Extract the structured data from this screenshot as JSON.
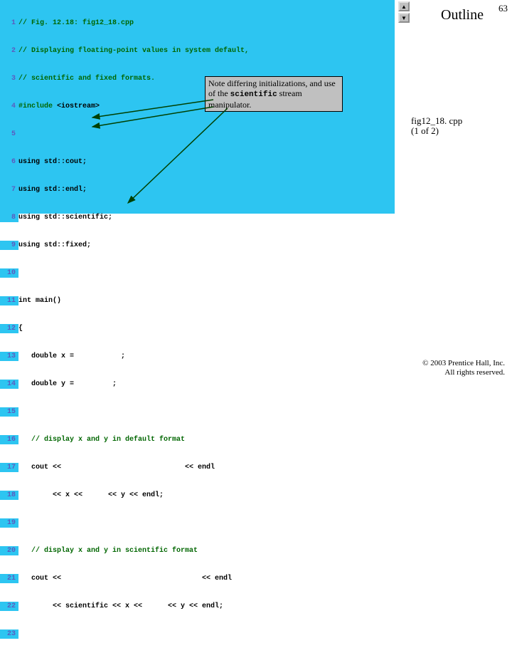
{
  "pageNumber": "63",
  "outlineLabel": "Outline",
  "nav": {
    "up": "▲",
    "down": "▼"
  },
  "figRefLine1": "fig12_18. cpp",
  "figRefLine2": "(1 of 2)",
  "callout": {
    "part1": "Note differing initializations, and use of the ",
    "mono": "scientific",
    "part2": " stream manipulator."
  },
  "footer": {
    "line1": "© 2003 Prentice Hall, Inc.",
    "line2": "All rights reserved."
  },
  "code": {
    "l1": "// Fig. 12.18: fig12_18.cpp",
    "l2": "// Displaying floating-point values in system default,",
    "l3": "// scientific and fixed formats.",
    "l4a": "#include ",
    "l4b": "<iostream>",
    "l5": "",
    "l6a": "using ",
    "l6b": "std::cout;",
    "l7a": "using ",
    "l7b": "std::endl;",
    "l8a": "using ",
    "l8b": "std::scientific;",
    "l9a": "using ",
    "l9b": "std::fixed;",
    "l10": "",
    "l11a": "int",
    "l11b": " main()",
    "l12": "{",
    "l13a": "   double",
    "l13b": " x =           ;",
    "l14a": "   double",
    "l14b": " y =         ;",
    "l15": "",
    "l16": "   // display x and y in default format",
    "l17": "   cout <<                             << endl",
    "l18": "        << x <<      << y << endl;",
    "l19": "",
    "l20": "   // display x and y in scientific format",
    "l21": "   cout <<                                 << endl",
    "l22": "        << scientific << x <<      << y << endl;",
    "l23": ""
  }
}
